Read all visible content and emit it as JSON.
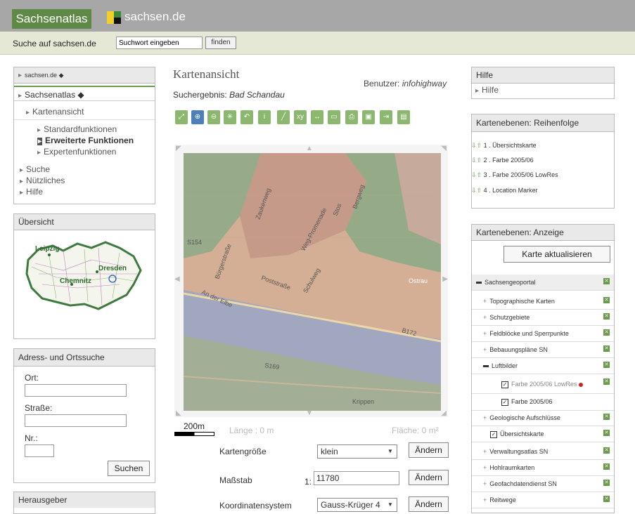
{
  "header": {
    "app_tab": "Sachsenatlas",
    "logo_text": "sachsen.de"
  },
  "search": {
    "label": "Suche auf sachsen.de",
    "placeholder": "Suchwort eingeben",
    "button": "finden"
  },
  "nav": {
    "root": "sachsen.de",
    "section": "Sachsenatlas",
    "sub": "Kartenansicht",
    "items": [
      "Standardfunktionen",
      "Erweiterte Funktionen",
      "Expertenfunktionen"
    ],
    "other": [
      "Suche",
      "Nützliches",
      "Hilfe"
    ]
  },
  "overview": {
    "title": "Übersicht",
    "cities": [
      "Leipzig",
      "Dresden",
      "Chemnitz"
    ]
  },
  "address": {
    "title": "Adress- und Ortssuche",
    "ort": "Ort:",
    "strasse": "Straße:",
    "nr": "Nr.:",
    "button": "Suchen"
  },
  "publisher": {
    "title": "Herausgeber"
  },
  "main": {
    "title": "Kartenansicht",
    "user_label": "Benutzer:",
    "user_value": "infohighway",
    "result_label": "Suchergebnis:",
    "result_value": "Bad Schandau"
  },
  "map": {
    "labels": [
      "Zaukenweg",
      "Weg-Promenade",
      "Stos",
      "Bergweg",
      "S154",
      "Bürgerstraße",
      "Poststraße",
      "Ostrau",
      "An der Elbe",
      "Schulweg",
      "B172",
      "S169",
      "Krippen"
    ],
    "scale_text": "200m",
    "length": "Länge : 0 m",
    "area": "Fläche: 0 m²"
  },
  "controls": {
    "size_label": "Kartengröße",
    "size_value": "klein",
    "scale_label": "Maßstab",
    "scale_prefix": "1:",
    "scale_value": "11780",
    "coord_label": "Koordinatensystem",
    "coord_value": "Gauss-Krüger 4",
    "change": "Ändern"
  },
  "help": {
    "title": "Hilfe",
    "link": "Hilfe"
  },
  "order": {
    "title": "Kartenebenen: Reihenfolge",
    "items": [
      "1 . Übersichtskarte",
      "2 . Farbe 2005/06",
      "3 . Farbe 2005/06 LowRes",
      "4 . Location Marker"
    ]
  },
  "display": {
    "title": "Kartenebenen: Anzeige",
    "refresh": "Karte aktualisieren",
    "rows": [
      "Sachsengeoportal",
      "Topographische Karten",
      "Schutzgebiete",
      "Feldblöcke und Sperrpunkte",
      "Bebauungspläne SN",
      "Luftbilder",
      "Farbe 2005/06 LowRes",
      "Farbe 2005/06",
      "Geologische Aufschlüsse",
      "Übersichtskarte",
      "Verwaltungsatlas SN",
      "Hohlraumkarten",
      "Geofachdatendienst SN",
      "Reitwege"
    ]
  },
  "colors": {
    "brand_green": "#5f8a45",
    "top_gray": "#a7a7a7",
    "accent_green": "#6b9a4e",
    "marker_red": "#cc2222"
  }
}
